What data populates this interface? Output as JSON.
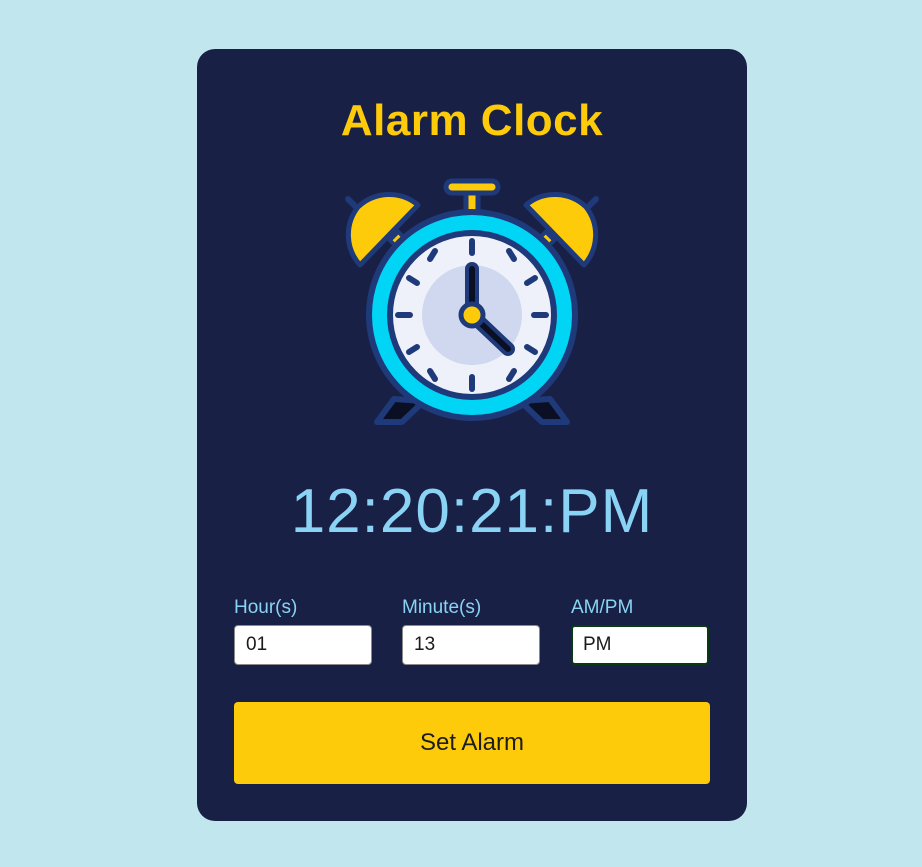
{
  "app": {
    "title": "Alarm Clock"
  },
  "clock": {
    "current_time": "12:20:21:PM",
    "icon": "alarm-clock-icon"
  },
  "form": {
    "hour": {
      "label": "Hour(s)",
      "value": "01"
    },
    "minute": {
      "label": "Minute(s)",
      "value": "13"
    },
    "ampm": {
      "label": "AM/PM",
      "value": "PM"
    }
  },
  "actions": {
    "set_alarm_label": "Set Alarm"
  },
  "colors": {
    "page_background": "#c2e6ee",
    "card_background": "#182145",
    "accent_yellow": "#fecb0a",
    "time_text": "#8ad3f4",
    "clock_ring": "#00d5f5",
    "clock_outline": "#1f3a7a"
  }
}
